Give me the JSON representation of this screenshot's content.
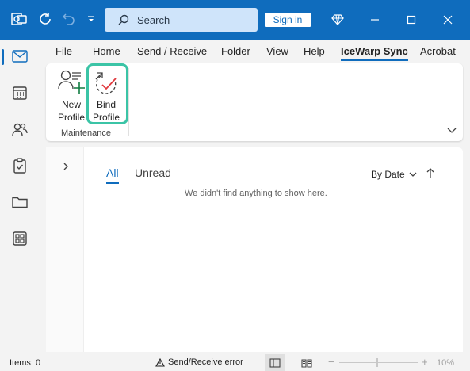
{
  "titlebar": {
    "search_placeholder": "Search",
    "signin_label": "Sign in",
    "icons": [
      "outlook-app-icon",
      "sync-icon",
      "undo-icon",
      "customize-qat-icon",
      "diamond-icon",
      "minimize-icon",
      "maximize-icon",
      "close-icon"
    ]
  },
  "rail": {
    "items": [
      {
        "name": "mail",
        "active": true
      },
      {
        "name": "calendar",
        "active": false
      },
      {
        "name": "people",
        "active": false
      },
      {
        "name": "tasks",
        "active": false
      },
      {
        "name": "folders",
        "active": false
      },
      {
        "name": "apps",
        "active": false
      }
    ]
  },
  "menu": {
    "tabs": [
      "File",
      "Home",
      "Send / Receive",
      "Folder",
      "View",
      "Help",
      "IceWarp Sync",
      "Acrobat"
    ],
    "active": "IceWarp Sync"
  },
  "ribbon": {
    "new_profile_label_1": "New",
    "new_profile_label_2": "Profile",
    "bind_profile_label_1": "Bind",
    "bind_profile_label_2": "Profile",
    "group_label": "Maintenance"
  },
  "pane": {
    "tab_all": "All",
    "tab_unread": "Unread",
    "sort_label": "By Date",
    "empty_message": "We didn't find anything to show here."
  },
  "statusbar": {
    "items": "Items: 0",
    "error": "Send/Receive error",
    "zoom": "10%"
  },
  "colors": {
    "accent": "#0f6cbd",
    "highlight": "#3bc4a6",
    "bind_check": "#e0393e"
  }
}
